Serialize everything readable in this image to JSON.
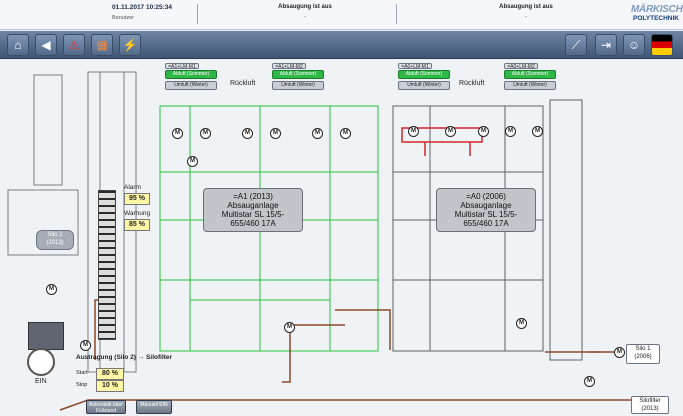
{
  "status": {
    "datetime": "01.11.2017 10:25:34",
    "user": "Benutzer",
    "msg1": "Absaugung ist aus",
    "msg1_sub": "-",
    "msg2": "Absaugung ist aus",
    "msg2_sub": "-",
    "logo_top": "MÄRKISCHE",
    "logo_bottom": "POLYTECHNIK"
  },
  "toolbar": {
    "icons": [
      "home-icon",
      "back-icon",
      "alarm-icon",
      "report-icon",
      "flash-icon",
      "tools-icon",
      "exit-icon",
      "user-icon",
      "flag-de-icon"
    ]
  },
  "plant_a1": {
    "title_line1": "=A1 (2013)",
    "title_line2": "Absauganlage",
    "title_line3": "Multistar SL 15/5-655/460 17A",
    "rueckluft": "Rückluft",
    "btn_sommer_auf": "Abluft (Sommer)",
    "btn_winter_auf": "Umluft (Winter)",
    "btn_sommer_zu": "Abluft (Sommer)",
    "btn_winter_zu": "Umluft (Winter)"
  },
  "plant_a0": {
    "title_line1": "=A0 (2006)",
    "title_line2": "Absauganlage",
    "title_line3": "Multistar SL 15/5-655/460 17A",
    "rueckluft": "Rückluft",
    "btn_sommer_auf": "Abluft (Sommer)",
    "btn_winter_auf": "Umluft (Winter)",
    "btn_sommer_zu": "Abluft (Sommer)",
    "btn_winter_zu": "Umluft (Winter)"
  },
  "silo2": {
    "name": "Silo 2",
    "year": "(2013)",
    "alarm_label": "Alarm",
    "alarm_value": "95 %",
    "warn_label": "Warnung",
    "warn_value": "85 %"
  },
  "austragung": {
    "title": "Austragung (Silo 2) → Silofilter",
    "start_label": "Start",
    "start_value": "80 %",
    "stop_label": "Stop",
    "stop_value": "10 %",
    "ein_label": "EIN",
    "btn_auto": "Automatik über Füllstand",
    "btn_manual": "Manuell EIN"
  },
  "silo1": {
    "name": "Silo 1",
    "year": "(2006)"
  },
  "silofilter": {
    "name": "Silofilter",
    "year": "(2013)"
  }
}
